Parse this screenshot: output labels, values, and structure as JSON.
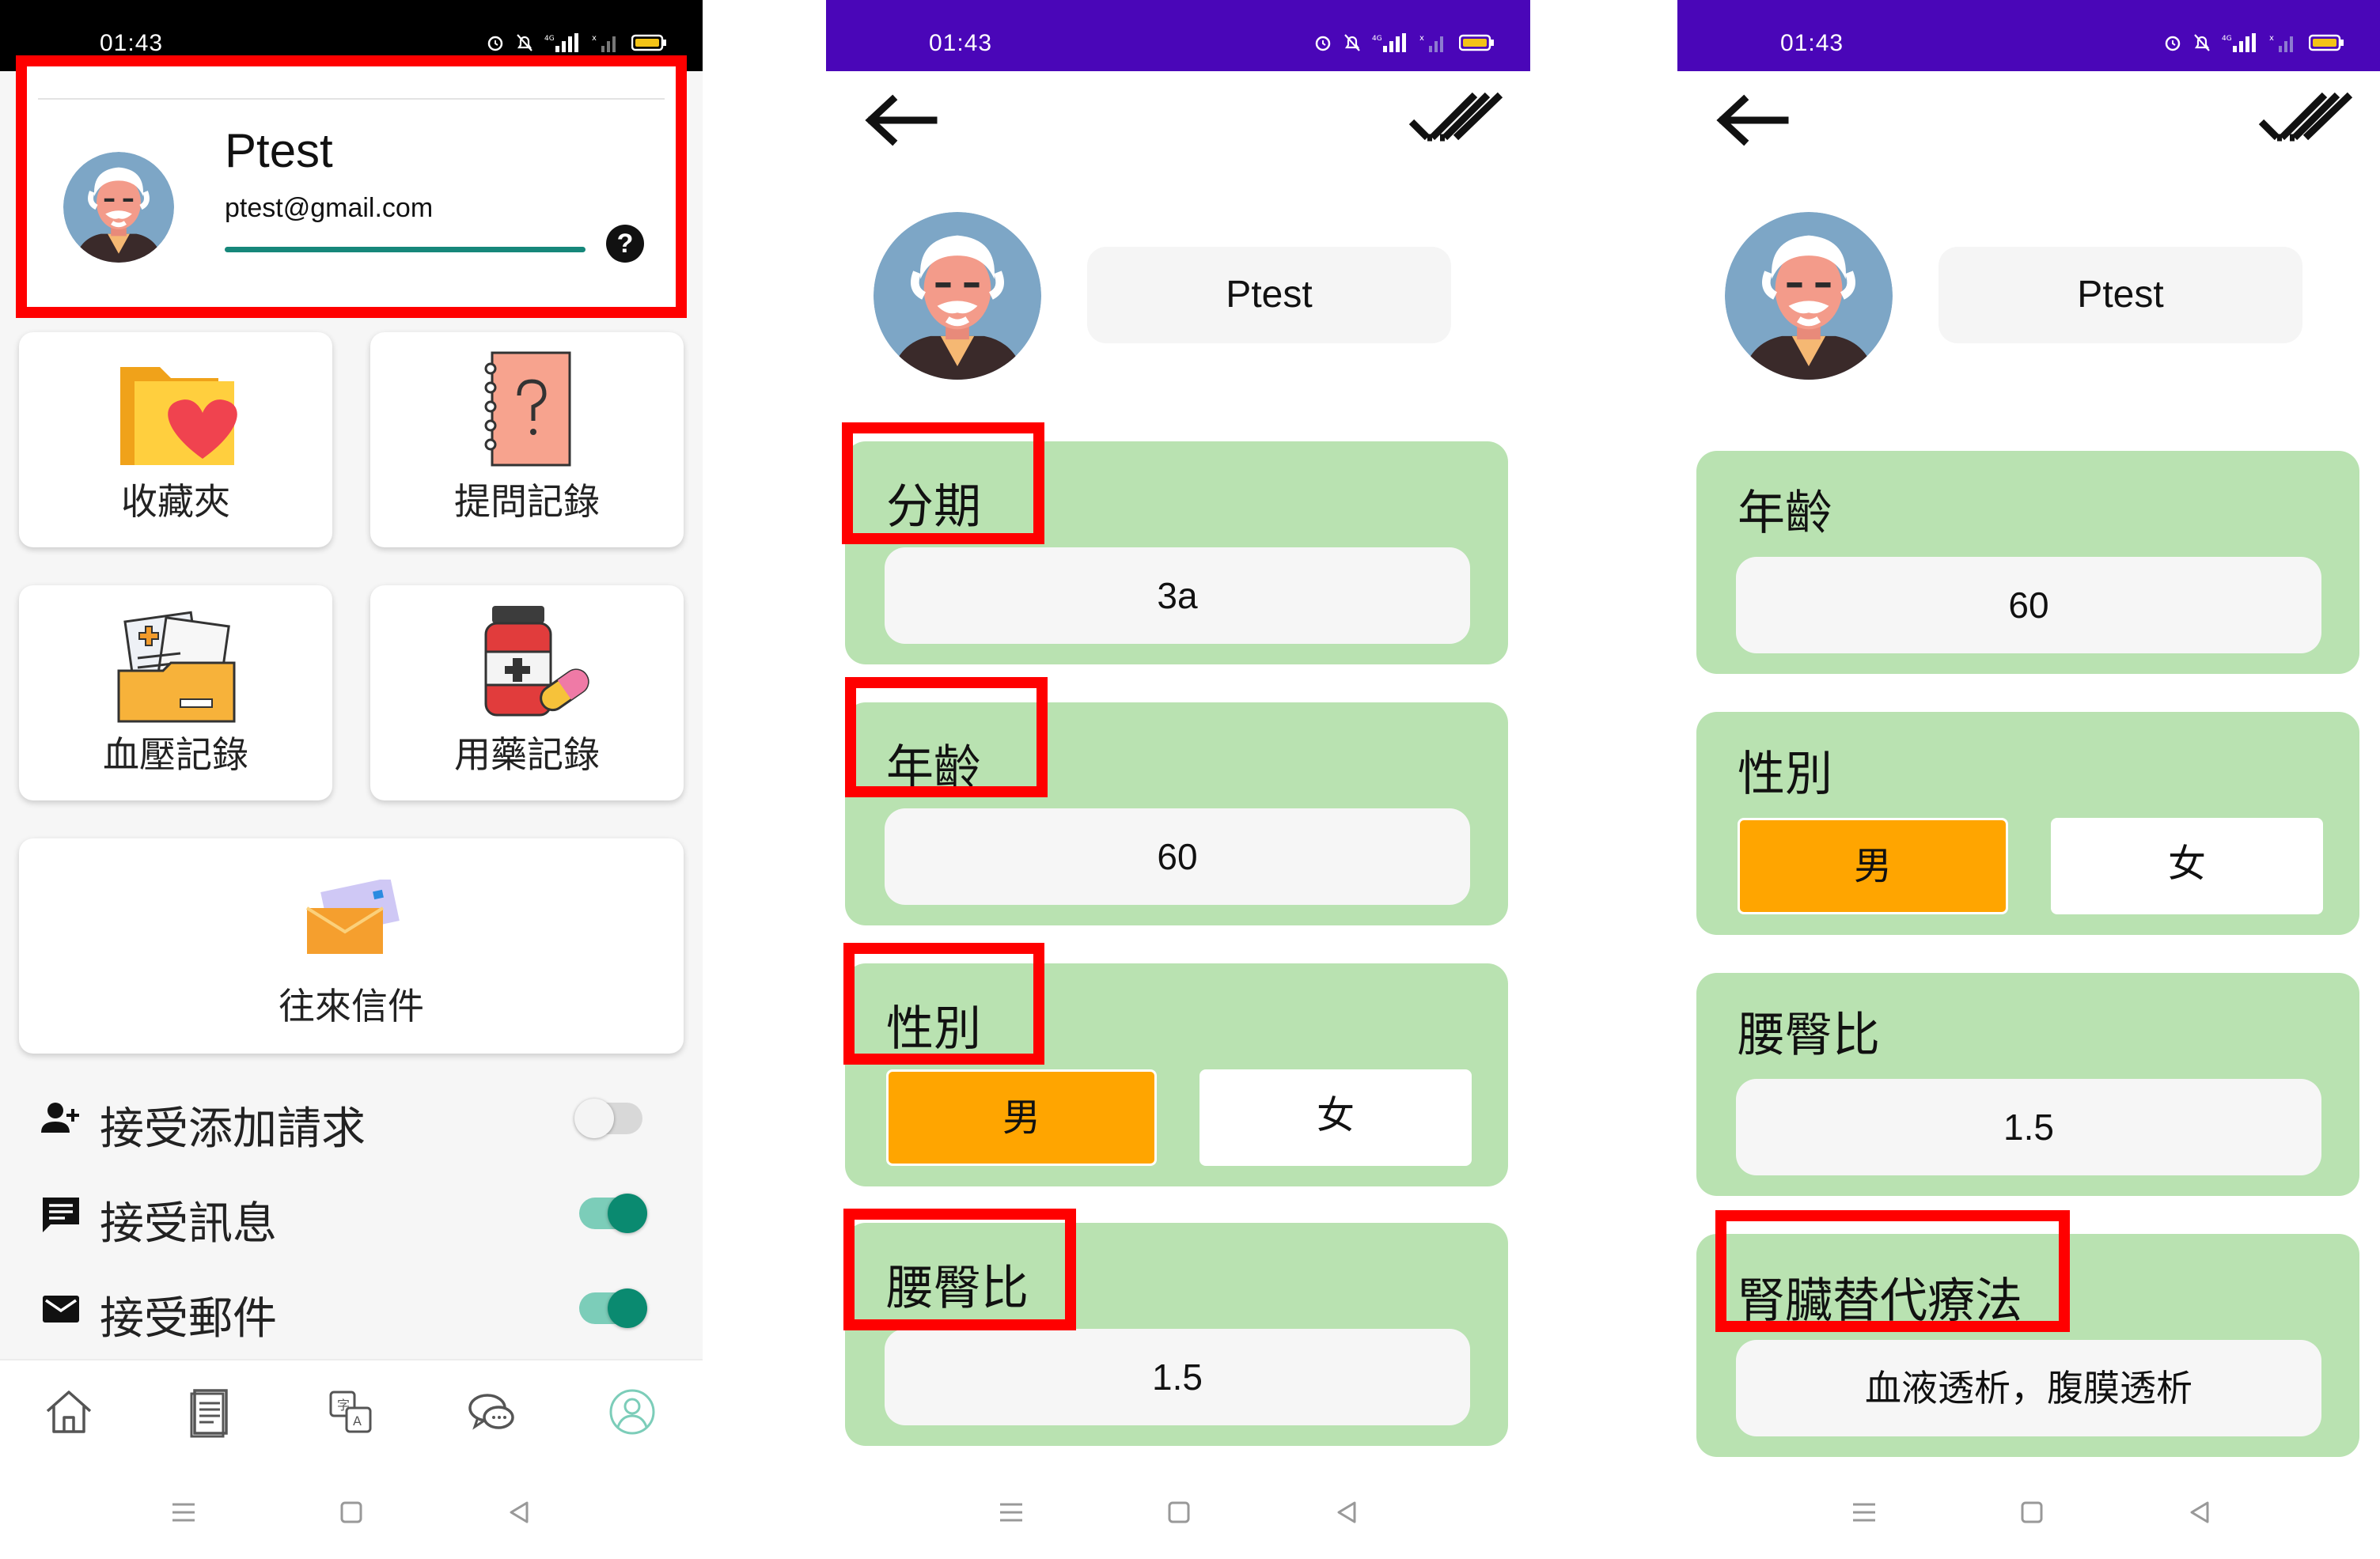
{
  "status_bar": {
    "time": "01:43"
  },
  "screen1": {
    "profile": {
      "name": "Ptest",
      "email": "ptest@gmail.com",
      "help": "?"
    },
    "tiles": {
      "favorites": "收藏夾",
      "questions": "提問記錄",
      "blood_pressure": "血壓記錄",
      "medication": "用藥記錄",
      "mail": "往來信件"
    },
    "settings": [
      {
        "label": "接受添加請求",
        "enabled": false
      },
      {
        "label": "接受訊息",
        "enabled": true
      },
      {
        "label": "接受郵件",
        "enabled": true
      }
    ],
    "bottom_nav": [
      "home-icon",
      "document-icon",
      "translate-icon",
      "chat-icon",
      "profile-icon"
    ],
    "active_nav": "profile-icon"
  },
  "screen2": {
    "name": "Ptest",
    "fields": {
      "stage": {
        "label": "分期",
        "value": "3a"
      },
      "age": {
        "label": "年齡",
        "value": "60"
      },
      "gender": {
        "label": "性別",
        "options": [
          "男",
          "女"
        ],
        "selected": "男"
      },
      "whr": {
        "label": "腰臀比",
        "value": "1.5"
      }
    }
  },
  "screen3": {
    "name": "Ptest",
    "fields": {
      "age": {
        "label": "年齡",
        "value": "60"
      },
      "gender": {
        "label": "性別",
        "options": [
          "男",
          "女"
        ],
        "selected": "男"
      },
      "whr": {
        "label": "腰臀比",
        "value": "1.5"
      },
      "rrt": {
        "label": "腎臟替代療法",
        "value": "血液透析，腹膜透析"
      }
    }
  },
  "colors": {
    "accent_purple": "#4a06b8",
    "card_green": "#b9e2b1",
    "selected_orange": "#ffa500",
    "toggle_teal": "#0a8a70",
    "annotation_red": "#ff0000"
  }
}
